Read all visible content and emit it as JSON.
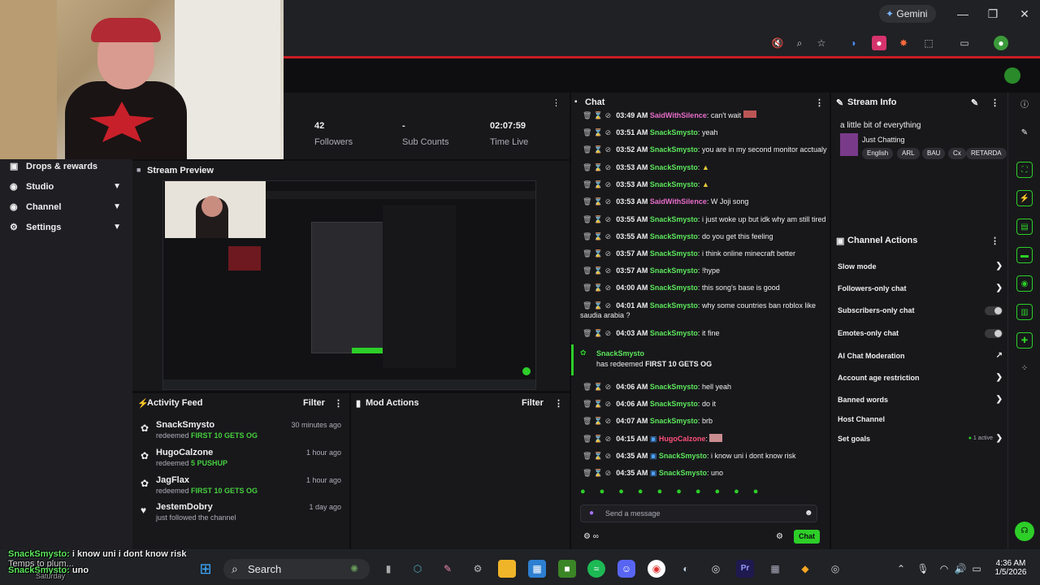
{
  "browser": {
    "gemini_label": "Gemini",
    "window_controls": [
      "minimize",
      "restore",
      "close"
    ]
  },
  "stats": [
    {
      "value": "42",
      "label": "Followers"
    },
    {
      "value": "-",
      "label": "Sub Counts"
    },
    {
      "value": "02:07:59",
      "label": "Time Live"
    }
  ],
  "nav": [
    {
      "label": "Drops & rewards",
      "icon": "gift-icon",
      "chevron": false
    },
    {
      "label": "Studio",
      "icon": "studio-icon",
      "chevron": true
    },
    {
      "label": "Channel",
      "icon": "channel-icon",
      "chevron": true
    },
    {
      "label": "Settings",
      "icon": "gear-icon",
      "chevron": true
    }
  ],
  "preview": {
    "title": "Stream Preview"
  },
  "activity": {
    "title": "Activity Feed",
    "filter_label": "Filter",
    "items": [
      {
        "name": "SnackSmysto",
        "action": "redeemed",
        "reward": "FIRST 10 GETS OG",
        "time": "30 minutes ago"
      },
      {
        "name": "HugoCalzone",
        "action": "redeemed",
        "reward": "5 PUSHUP",
        "time": "1 hour ago"
      },
      {
        "name": "JagFlax",
        "action": "redeemed",
        "reward": "FIRST 10 GETS OG",
        "time": "1 hour ago"
      },
      {
        "name": "JestemDobry",
        "action": "just followed the channel",
        "reward": "",
        "time": "1 day ago"
      }
    ]
  },
  "mod_actions": {
    "title": "Mod Actions",
    "filter_label": "Filter"
  },
  "chat": {
    "title": "Chat",
    "placeholder": "Send a message",
    "chat_button": "Chat",
    "messages": [
      {
        "time": "03:49 AM",
        "user": "SaidWithSilence",
        "text": "can't wait"
      },
      {
        "time": "03:51 AM",
        "user": "SnackSmysto",
        "text": "yeah"
      },
      {
        "time": "03:52 AM",
        "user": "SnackSmysto",
        "text": "you are in my second monitor acctualy"
      },
      {
        "time": "03:53 AM",
        "user": "SnackSmysto",
        "text": ""
      },
      {
        "time": "03:53 AM",
        "user": "SnackSmysto",
        "text": ""
      },
      {
        "time": "03:53 AM",
        "user": "SaidWithSilence",
        "text": "W Joji song"
      },
      {
        "time": "03:55 AM",
        "user": "SnackSmysto",
        "text": "i just woke up but idk why am still tired"
      },
      {
        "time": "03:55 AM",
        "user": "SnackSmysto",
        "text": "do you get this feeling"
      },
      {
        "time": "03:57 AM",
        "user": "SnackSmysto",
        "text": "i think online minecraft better"
      },
      {
        "time": "03:57 AM",
        "user": "SnackSmysto",
        "text": "!hype"
      },
      {
        "time": "04:00 AM",
        "user": "SnackSmysto",
        "text": "this song's base is good"
      },
      {
        "time": "04:01 AM",
        "user": "SnackSmysto",
        "text": "why some countries ban roblox like"
      },
      {
        "time": "04:03 AM",
        "user": "SnackSmysto",
        "text": "it fine"
      },
      {
        "time": "04:06 AM",
        "user": "SnackSmysto",
        "text": "hell yeah"
      },
      {
        "time": "04:06 AM",
        "user": "SnackSmysto",
        "text": "do it"
      },
      {
        "time": "04:07 AM",
        "user": "SnackSmysto",
        "text": "brb"
      },
      {
        "time": "04:15 AM",
        "user": "HugoCalzone",
        "text": ""
      },
      {
        "time": "04:35 AM",
        "user": "SnackSmysto",
        "text": "i know uni i dont know risk"
      },
      {
        "time": "04:35 AM",
        "user": "SnackSmysto",
        "text": "uno"
      }
    ],
    "wrap_line": "saudia arabia ?",
    "redemption": {
      "user": "SnackSmysto",
      "prefix": "has redeemed",
      "reward": "FIRST 10 GETS OG"
    }
  },
  "stream_info": {
    "title": "Stream Info",
    "stream_title": "a little bit of everything",
    "category": "Just Chatting",
    "tags": [
      "English",
      "ARL",
      "BAU",
      "Cx",
      "RETARDA"
    ]
  },
  "channel_actions": {
    "title": "Channel Actions",
    "items": [
      {
        "label": "Slow mode",
        "control": "chevron"
      },
      {
        "label": "Followers-only chat",
        "control": "chevron"
      },
      {
        "label": "Subscribers-only chat",
        "control": "toggle"
      },
      {
        "label": "Emotes-only chat",
        "control": "toggle"
      },
      {
        "label": "AI Chat Moderation",
        "control": "external"
      },
      {
        "label": "Account age restriction",
        "control": "chevron"
      },
      {
        "label": "Banned words",
        "control": "chevron"
      },
      {
        "label": "Host Channel",
        "control": "none"
      },
      {
        "label": "Set goals",
        "control": "chevron"
      }
    ],
    "goals_status": "1 active"
  },
  "taskbar": {
    "search_label": "Search",
    "time": "4:36 AM",
    "date": "1/5/2026"
  },
  "overlay": {
    "line1_user": "SnackSmysto:",
    "line1_text": "i know uni i dont know risk",
    "line2_prefix": "Temps to plum...",
    "line2_user": "SnackSmysto:",
    "line2_text": "uno",
    "line3": "Saturday"
  },
  "colors": {
    "accent": "#45d13e",
    "snack_user": "#5ce65c",
    "said_user": "#e86dc9",
    "hugo_user": "#ff4f7a",
    "rec_red": "#c81d25"
  }
}
